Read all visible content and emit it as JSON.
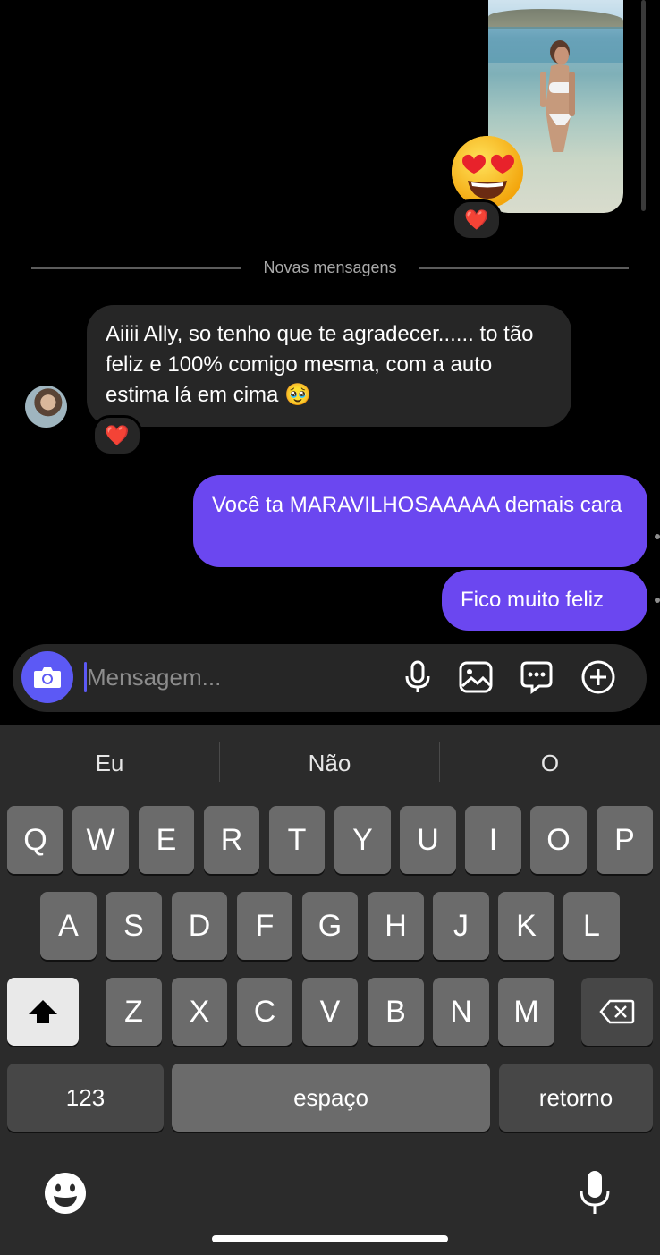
{
  "chat": {
    "divider_label": "Novas mensagens",
    "incoming_message": {
      "text": "Aiiii Ally, so tenho que te agradecer...... to tão feliz e 100% comigo mesma, com a auto estima lá em cima 🥹",
      "reaction": "❤️"
    },
    "photo_reaction": "❤️",
    "photo_emoji": "😍",
    "outgoing_messages": [
      {
        "text": "Você ta MARAVILHOSAAAAA demais cara"
      },
      {
        "text": "Fico muito feliz"
      }
    ]
  },
  "composer": {
    "placeholder": "Mensagem...",
    "icons": [
      "camera-icon",
      "microphone-icon",
      "gallery-icon",
      "sticker-icon",
      "plus-icon"
    ]
  },
  "keyboard": {
    "suggestions": [
      "Eu",
      "Não",
      "O"
    ],
    "rows": [
      [
        "Q",
        "W",
        "E",
        "R",
        "T",
        "Y",
        "U",
        "I",
        "O",
        "P"
      ],
      [
        "A",
        "S",
        "D",
        "F",
        "G",
        "H",
        "J",
        "K",
        "L"
      ],
      [
        "Z",
        "X",
        "C",
        "V",
        "B",
        "N",
        "M"
      ]
    ],
    "numbers_label": "123",
    "space_label": "espaço",
    "return_label": "retorno"
  },
  "colors": {
    "accent": "#6b47f0",
    "camera_button": "#5c59f5",
    "incoming_bubble": "#262626",
    "keyboard_bg": "#2b2b2b"
  }
}
